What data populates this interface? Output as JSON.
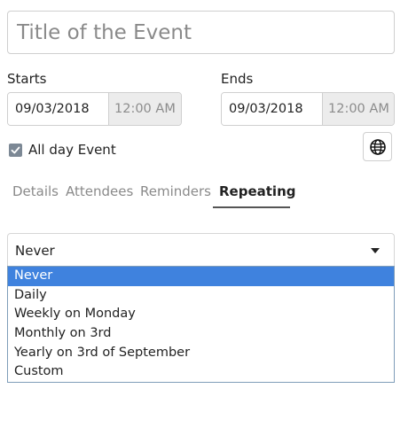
{
  "event": {
    "title_placeholder": "Title of the Event",
    "title_value": ""
  },
  "starts": {
    "label": "Starts",
    "date": "09/03/2018",
    "time": "12:00 AM"
  },
  "ends": {
    "label": "Ends",
    "date": "09/03/2018",
    "time": "12:00 AM"
  },
  "all_day": {
    "label": "All day Event",
    "checked": true
  },
  "timezone": {
    "icon": "globe-icon"
  },
  "tabs": [
    {
      "label": "Details",
      "active": false
    },
    {
      "label": "Attendees",
      "active": false
    },
    {
      "label": "Reminders",
      "active": false
    },
    {
      "label": "Repeating",
      "active": true
    }
  ],
  "repeat": {
    "selected": "Never",
    "options": [
      "Never",
      "Daily",
      "Weekly on Monday",
      "Monthly on 3rd",
      "Yearly on 3rd of September",
      "Custom"
    ]
  },
  "colors": {
    "accent": "#3f82de",
    "checkbox": "#7c8895"
  }
}
